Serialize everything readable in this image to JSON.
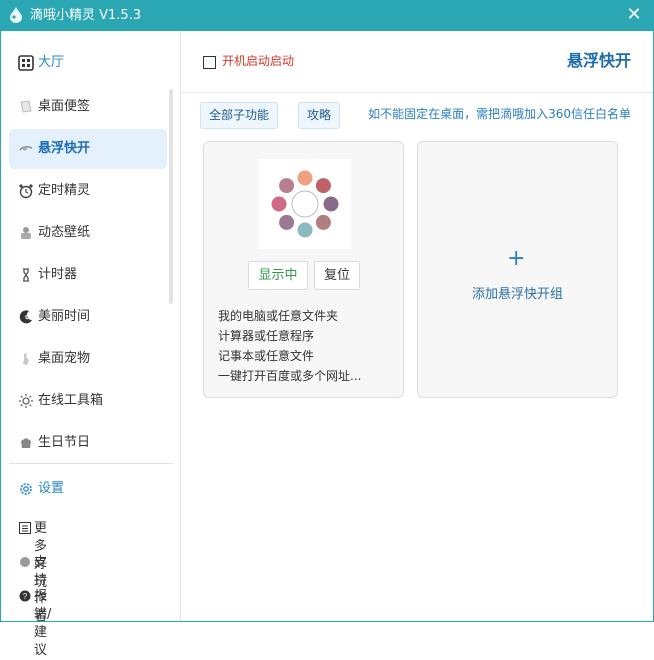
{
  "window": {
    "title": "滴哦小精灵 V1.5.3"
  },
  "sidebar": {
    "items": [
      {
        "label": "大厅",
        "icon": "grid-icon"
      },
      {
        "label": "桌面便签",
        "icon": "note-icon"
      },
      {
        "label": "悬浮快开",
        "icon": "float-icon"
      },
      {
        "label": "定时精灵",
        "icon": "alarm-clock-icon"
      },
      {
        "label": "动态壁纸",
        "icon": "wallpaper-icon"
      },
      {
        "label": "计时器",
        "icon": "hourglass-icon"
      },
      {
        "label": "美丽时间",
        "icon": "moon-clock-icon"
      },
      {
        "label": "桌面宠物",
        "icon": "pet-icon"
      },
      {
        "label": "在线工具箱",
        "icon": "sun-gear-icon"
      },
      {
        "label": "生日节日",
        "icon": "gift-icon"
      },
      {
        "label": "设置",
        "icon": "gear-icon"
      }
    ],
    "footer": [
      {
        "label": "更多好玩",
        "icon": "list-icon"
      },
      {
        "label": "支持作者",
        "icon": "heart-dot-icon"
      },
      {
        "label": "报错/建议",
        "icon": "question-icon"
      }
    ]
  },
  "header": {
    "autostart_label": "开机启动启动",
    "page_title": "悬浮快开"
  },
  "toolbar": {
    "all_sub_label": "全部子功能",
    "guide_label": "攻略",
    "hint": "如不能固定在桌面，需把滴哦加入360信任白名单"
  },
  "card1": {
    "show_label": "显示中",
    "reset_label": "复位",
    "features": [
      "我的电脑或任意文件夹",
      "计算器或任意程序",
      "记事本或任意文件",
      "一键打开百度或多个网址..."
    ],
    "petal_colors": [
      "#f0a07f",
      "#c0606a",
      "#8a6a8a",
      "#b08080",
      "#8ab9c0",
      "#9a7a90",
      "#d06a84",
      "#b68090"
    ]
  },
  "card2": {
    "plus": "+",
    "add_label": "添加悬浮快开组"
  },
  "colors": {
    "accent": "#2aa7b3",
    "link": "#2a7fc0",
    "danger": "#d23b2a"
  }
}
